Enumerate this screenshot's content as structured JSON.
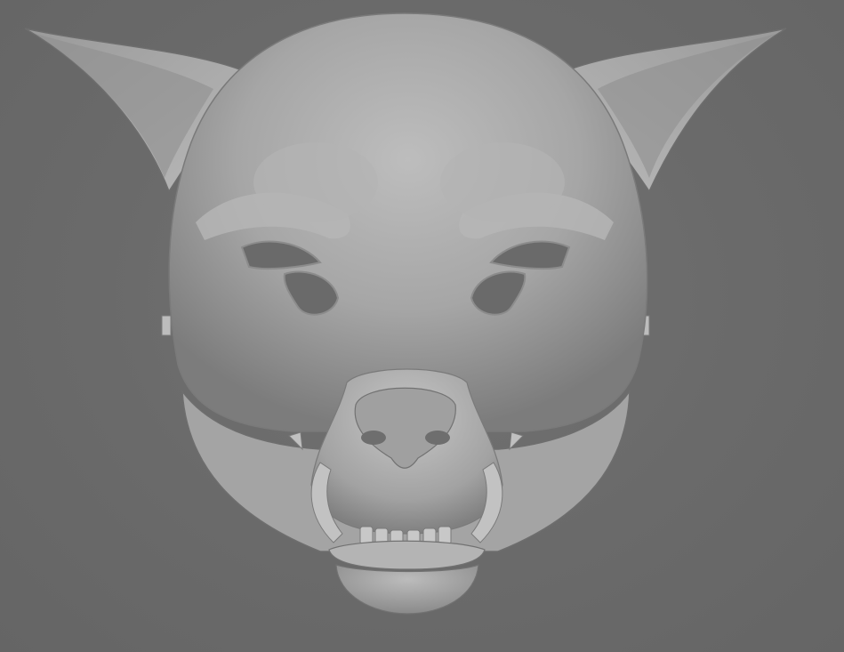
{
  "viewport": {
    "background_color": "#6b6b6b",
    "subject": "sculpted-cat-mask",
    "material_color": "#a8a8a8",
    "shadow_color": "#4a4a4a",
    "highlight_color": "#d0d0d0"
  }
}
